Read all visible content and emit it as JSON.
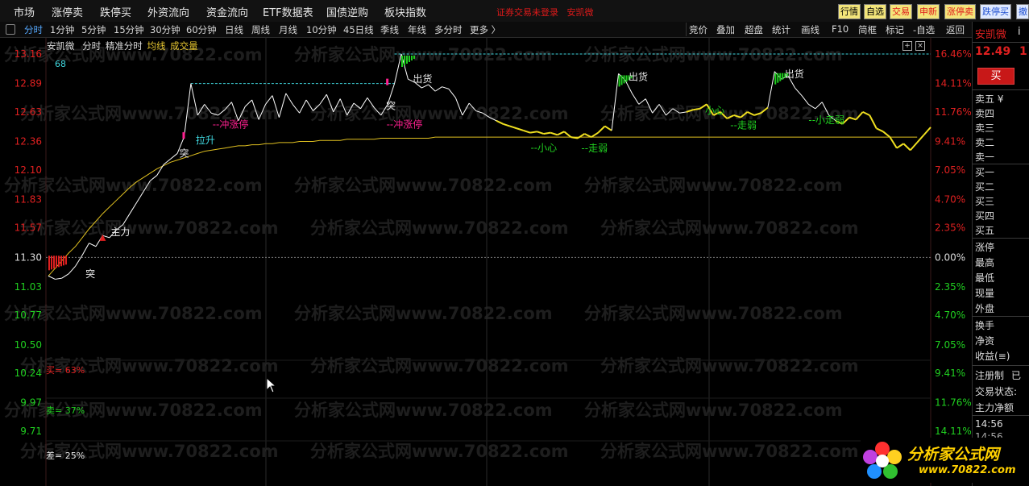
{
  "menu": {
    "items": [
      "市场",
      "涨停卖",
      "跌停买",
      "外资流向",
      "资金流向",
      "ETF数据表",
      "国债逆购",
      "板块指数"
    ],
    "notice": "证券交易未登录",
    "notice_stock": "安凯微",
    "quick_buttons": [
      "行情",
      "自选",
      "交易",
      "申新",
      "涨停卖",
      "跌停买",
      "撤"
    ]
  },
  "periods": {
    "tabs": [
      "分时",
      "1分钟",
      "5分钟",
      "15分钟",
      "30分钟",
      "60分钟",
      "日线",
      "周线",
      "月线",
      "10分钟",
      "45日线",
      "季线",
      "年线",
      "多分时",
      "更多 〉"
    ],
    "active": "分时",
    "tools": [
      "竞价",
      "叠加",
      "超盘",
      "统计",
      "画线",
      "F10",
      "简框",
      "标记",
      "-自选",
      "返回"
    ]
  },
  "chart": {
    "stock_name": "安凯微",
    "mode1": "分时",
    "mode2": "精准分时",
    "legend_avg": "均线",
    "legend_vol": "成交量",
    "count_label": "68",
    "price_ticks": [
      "13.16",
      "12.89",
      "12.63",
      "12.36",
      "12.10",
      "11.83",
      "11.57",
      "11.30",
      "11.03",
      "10.77",
      "10.50",
      "10.24",
      "9.97",
      "9.71"
    ],
    "pct_ticks": [
      "16.46%",
      "14.11%",
      "11.76%",
      "9.41%",
      "7.05%",
      "4.70%",
      "2.35%",
      "0.00%",
      "2.35%",
      "4.70%",
      "7.05%",
      "9.41%",
      "11.76%",
      "14.11%"
    ],
    "buy_ratio": "买= 63%",
    "sell_ratio": "卖= 37%",
    "diff_ratio": "差= 25%",
    "annotations": {
      "zhuli": "主力",
      "tu1": "突",
      "tu2": "突",
      "tu3": "突",
      "lasheng": "拉升",
      "chong1": "--冲涨停",
      "chong2": "--冲涨停",
      "chuhuo1": "出货",
      "chuhuo2": "出货",
      "chuhuo3": "出货",
      "xiaoxin1": "--小心",
      "xiaoxin2": "小心",
      "zouruo1": "--走弱",
      "zouruo2": "--走弱",
      "zouruo3": "--小走弱"
    },
    "colors": {
      "price": "#ffffff",
      "price_weak": "#f0e020",
      "avg": "#e0c020",
      "up": "#e02020",
      "down": "#20d020",
      "pink": "#ff2090",
      "cyan": "#40d8e0"
    },
    "series": {
      "name_price": "price",
      "name_avg": "avg",
      "price": [
        11.13,
        11.1,
        11.11,
        11.15,
        11.22,
        11.32,
        11.43,
        11.4,
        11.5,
        11.48,
        11.55,
        11.6,
        11.7,
        11.8,
        11.9,
        12.0,
        12.05,
        12.15,
        12.2,
        12.25,
        12.4,
        12.89,
        12.6,
        12.7,
        12.62,
        12.6,
        12.65,
        12.72,
        12.55,
        12.68,
        12.74,
        12.56,
        12.7,
        12.78,
        12.58,
        12.8,
        12.7,
        12.62,
        12.74,
        12.64,
        12.7,
        12.79,
        12.63,
        12.75,
        12.6,
        12.71,
        12.66,
        12.76,
        12.67,
        12.6,
        12.7,
        12.89,
        13.16,
        12.93,
        12.9,
        12.85,
        12.88,
        12.82,
        12.86,
        12.84,
        12.76,
        12.6,
        12.71,
        12.64,
        12.62,
        12.58,
        12.55,
        12.52,
        12.5,
        12.48,
        12.46,
        12.44,
        12.45,
        12.43,
        12.44,
        12.42,
        12.45,
        12.4,
        12.39,
        12.43,
        12.4,
        12.44,
        12.5,
        12.46,
        12.98,
        12.92,
        12.8,
        12.7,
        12.75,
        12.62,
        12.7,
        12.6,
        12.66,
        12.62,
        12.63,
        12.65,
        12.66,
        12.7,
        12.6,
        12.63,
        12.57,
        12.6,
        12.58,
        12.63,
        12.6,
        12.62,
        12.67,
        13.0,
        12.93,
        12.96,
        12.85,
        12.78,
        12.7,
        12.66,
        12.72,
        12.6,
        12.55,
        12.52,
        12.58,
        12.56,
        12.63,
        12.6,
        12.48,
        12.45,
        12.4,
        12.3,
        12.34,
        12.28,
        12.35,
        12.42,
        12.49
      ],
      "avg": [
        11.13,
        11.2,
        11.27,
        11.34,
        11.4,
        11.48,
        11.56,
        11.63,
        11.7,
        11.76,
        11.82,
        11.88,
        11.94,
        11.99,
        12.03,
        12.07,
        12.11,
        12.14,
        12.17,
        12.19,
        12.21,
        12.23,
        12.25,
        12.27,
        12.28,
        12.29,
        12.3,
        12.31,
        12.32,
        12.32,
        12.33,
        12.33,
        12.34,
        12.34,
        12.35,
        12.35,
        12.35,
        12.36,
        12.36,
        12.36,
        12.37,
        12.37,
        12.37,
        12.37,
        12.38,
        12.38,
        12.38,
        12.38,
        12.38,
        12.39,
        12.39,
        12.39,
        12.39,
        12.39,
        12.39,
        12.39,
        12.39,
        12.4,
        12.4,
        12.4,
        12.4,
        12.4,
        12.4,
        12.4,
        12.4,
        12.4,
        12.4,
        12.4,
        12.4,
        12.4,
        12.4,
        12.4,
        12.4,
        12.4,
        12.4,
        12.4,
        12.4,
        12.4,
        12.4,
        12.4,
        12.4,
        12.4,
        12.4,
        12.4,
        12.4,
        12.4,
        12.4,
        12.4,
        12.4,
        12.4,
        12.4,
        12.4,
        12.4,
        12.4,
        12.4,
        12.4,
        12.4,
        12.4,
        12.4,
        12.4,
        12.4,
        12.4,
        12.4,
        12.4,
        12.4,
        12.4,
        12.4,
        12.4,
        12.4,
        12.4,
        12.4,
        12.4,
        12.4,
        12.4,
        12.4,
        12.4,
        12.4,
        12.4,
        12.4,
        12.4,
        12.4,
        12.4,
        12.4,
        12.4,
        12.4,
        12.4,
        12.4,
        12.4,
        12.4
      ],
      "ylim": [
        9.71,
        13.16
      ]
    },
    "cursor_icon": "mouse-pointer-icon"
  },
  "side": {
    "title": "安凯微",
    "code_short": "i",
    "price": "12.49",
    "price_suffix": "1",
    "buy_button": "买",
    "sell_rows": [
      "卖五 ¥",
      "卖四",
      "卖三",
      "卖二",
      "卖一"
    ],
    "buy_rows": [
      "买一",
      "买二",
      "买三",
      "买四",
      "买五"
    ],
    "stat_rows": [
      "涨停",
      "最高",
      "最低",
      "现量",
      "外盘"
    ],
    "stat_rows2": [
      "换手",
      "净资",
      "收益(≡)"
    ],
    "info_rows": [
      "注册制",
      "已",
      "交易状态:",
      "主力净额"
    ],
    "times": [
      "14:56",
      "14:56"
    ]
  },
  "logo": {
    "text": "分析家公式网",
    "url": "www.70822.com",
    "watermark": "分析家公式网www.70822.com"
  }
}
